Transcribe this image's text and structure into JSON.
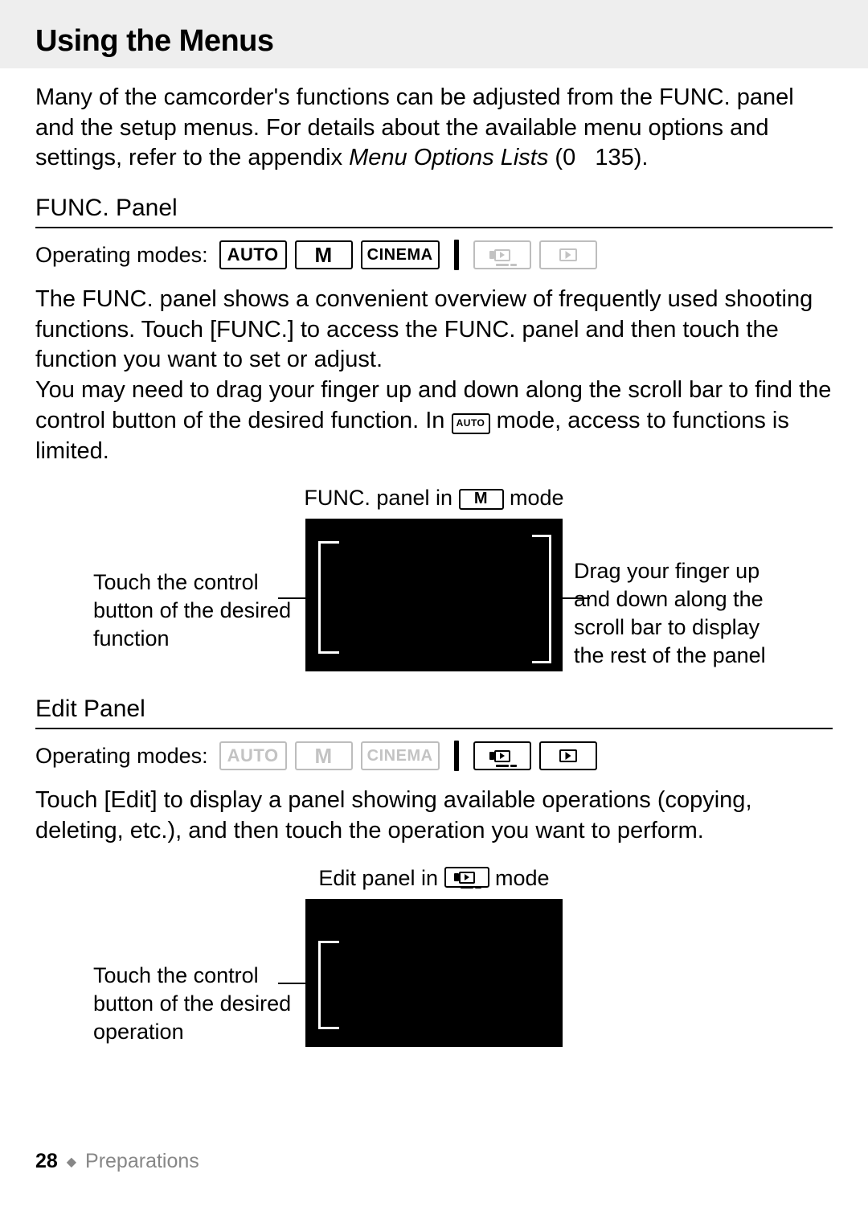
{
  "title": "Using the Menus",
  "intro_pre": "Many of the camcorder's functions can be adjusted from the FUNC. panel and the setup menus. For details about the available menu options and settings, refer to the appendix ",
  "intro_em": "Menu Options Lists",
  "intro_post": " (0   135).",
  "func": {
    "heading": "FUNC. Panel",
    "opmodes_label": "Operating modes:",
    "modes": {
      "auto": "AUTO",
      "m": "M",
      "cinema": "CINEMA"
    },
    "body_pre": "The FUNC. panel shows a convenient overview of frequently used shooting functions. Touch [FUNC.] to access the FUNC. panel and then touch the function you want to set or adjust.\nYou may need to drag your finger up and down along the scroll bar to find the control button of the desired function. In ",
    "body_chip": "AUTO",
    "body_post": " mode, access to functions is limited.",
    "caption_pre": "FUNC. panel in ",
    "caption_chip": "M",
    "caption_post": " mode",
    "left_text": "Touch the control button of the desired function",
    "right_text": "Drag your finger up and down along the scroll bar to display the rest of the panel"
  },
  "edit": {
    "heading": "Edit Panel",
    "opmodes_label": "Operating modes:",
    "modes": {
      "auto": "AUTO",
      "m": "M",
      "cinema": "CINEMA"
    },
    "body": "Touch [Edit] to display a panel showing available operations (copying, deleting, etc.), and then touch the operation you want to perform.",
    "caption_pre": "Edit panel in ",
    "caption_post": " mode",
    "left_text": "Touch the control button of the desired operation"
  },
  "footer": {
    "page": "28",
    "chapter": "Preparations"
  }
}
